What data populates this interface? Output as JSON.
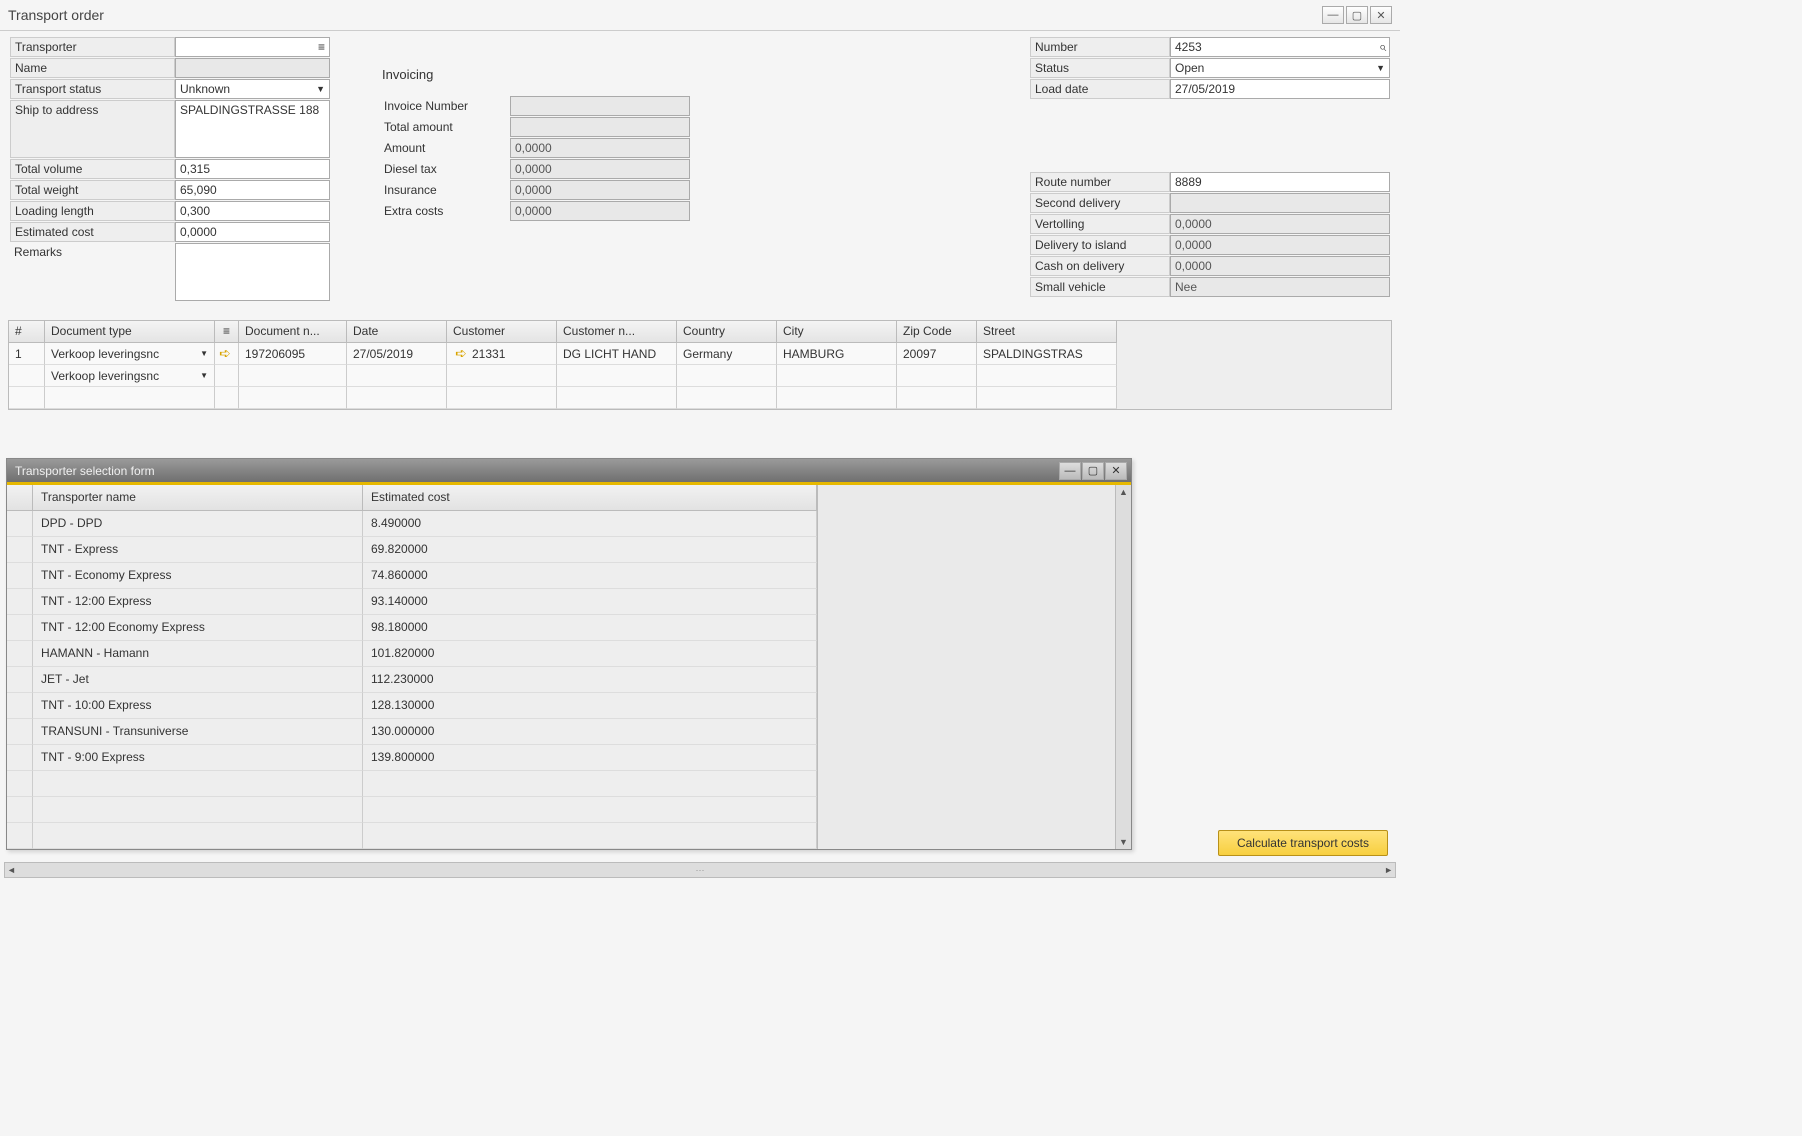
{
  "window_title": "Transport order",
  "left": {
    "transporter_label": "Transporter",
    "transporter_value": "",
    "name_label": "Name",
    "name_value": "",
    "transport_status_label": "Transport status",
    "transport_status_value": "Unknown",
    "ship_to_label": "Ship to address",
    "ship_to_value": "SPALDINGSTRASSE 188",
    "total_volume_label": "Total volume",
    "total_volume_value": "0,315",
    "total_weight_label": "Total weight",
    "total_weight_value": "65,090",
    "loading_length_label": "Loading length",
    "loading_length_value": "0,300",
    "estimated_cost_label": "Estimated cost",
    "estimated_cost_value": "0,0000",
    "remarks_label": "Remarks",
    "remarks_value": ""
  },
  "mid": {
    "section": "Invoicing",
    "invoice_number_label": "Invoice Number",
    "invoice_number_value": "",
    "total_amount_label": "Total amount",
    "total_amount_value": "",
    "amount_label": "Amount",
    "amount_value": "0,0000",
    "diesel_tax_label": "Diesel tax",
    "diesel_tax_value": "0,0000",
    "insurance_label": "Insurance",
    "insurance_value": "0,0000",
    "extra_costs_label": "Extra costs",
    "extra_costs_value": "0,0000"
  },
  "right": {
    "number_label": "Number",
    "number_value": "4253",
    "status_label": "Status",
    "status_value": "Open",
    "load_date_label": "Load date",
    "load_date_value": "27/05/2019",
    "route_number_label": "Route number",
    "route_number_value": "8889",
    "second_delivery_label": "Second delivery",
    "second_delivery_value": "",
    "vertolling_label": "Vertolling",
    "vertolling_value": "0,0000",
    "delivery_island_label": "Delivery to island",
    "delivery_island_value": "0,0000",
    "cash_on_delivery_label": "Cash on delivery",
    "cash_on_delivery_value": "0,0000",
    "small_vehicle_label": "Small vehicle",
    "small_vehicle_value": "Nee"
  },
  "grid": {
    "headers": {
      "num": "#",
      "doc_type": "Document type",
      "link": "≡",
      "doc_num": "Document n...",
      "date": "Date",
      "customer": "Customer",
      "customer_name": "Customer n...",
      "country": "Country",
      "city": "City",
      "zip": "Zip Code",
      "street": "Street"
    },
    "rows": [
      {
        "num": "1",
        "doc_type": "Verkoop leveringsnc",
        "doc_num": "197206095",
        "date": "27/05/2019",
        "customer": "21331",
        "customer_name": "DG LICHT HAND",
        "country": "Germany",
        "city": "HAMBURG",
        "zip": "20097",
        "street": "SPALDINGSTRAS"
      },
      {
        "num": "",
        "doc_type": "Verkoop leveringsnc",
        "doc_num": "",
        "date": "",
        "customer": "",
        "customer_name": "",
        "country": "",
        "city": "",
        "zip": "",
        "street": ""
      }
    ]
  },
  "subwin": {
    "title": "Transporter selection form",
    "headers": {
      "name": "Transporter name",
      "cost": "Estimated cost"
    },
    "rows": [
      {
        "name": "DPD - DPD",
        "cost": "8.490000"
      },
      {
        "name": "TNT - Express",
        "cost": "69.820000"
      },
      {
        "name": "TNT - Economy Express",
        "cost": "74.860000"
      },
      {
        "name": "TNT - 12:00 Express",
        "cost": "93.140000"
      },
      {
        "name": "TNT - 12:00 Economy Express",
        "cost": "98.180000"
      },
      {
        "name": "HAMANN - Hamann",
        "cost": "101.820000"
      },
      {
        "name": "JET - Jet",
        "cost": "112.230000"
      },
      {
        "name": "TNT - 10:00 Express",
        "cost": "128.130000"
      },
      {
        "name": "TRANSUNI - Transuniverse",
        "cost": "130.000000"
      },
      {
        "name": "TNT - 9:00 Express",
        "cost": "139.800000"
      }
    ]
  },
  "calc_button": "Calculate transport costs"
}
